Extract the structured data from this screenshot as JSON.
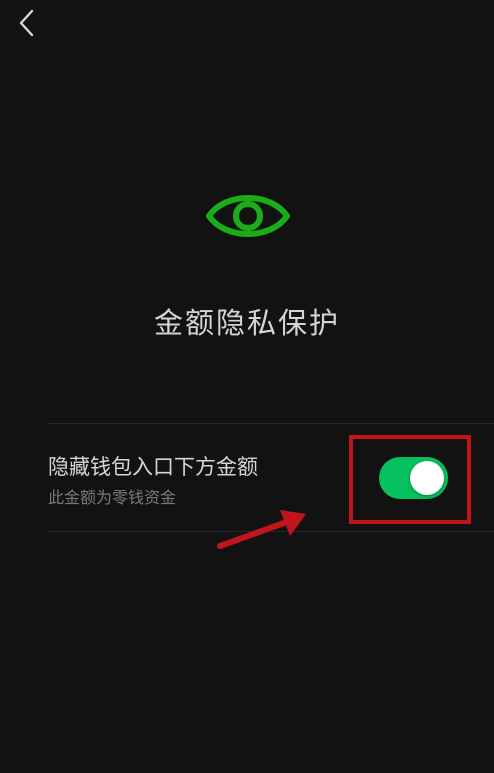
{
  "header": {
    "back_icon": "chevron-left-icon"
  },
  "hero": {
    "icon": "eye-icon",
    "icon_color": "#1aad19",
    "title": "金额隐私保护"
  },
  "setting": {
    "label": "隐藏钱包入口下方金额",
    "description": "此金额为零钱资金",
    "toggle_on": true,
    "toggle_color": "#07c160"
  },
  "annotation": {
    "highlight_color": "#c0161b",
    "arrow_icon": "arrow-icon"
  }
}
